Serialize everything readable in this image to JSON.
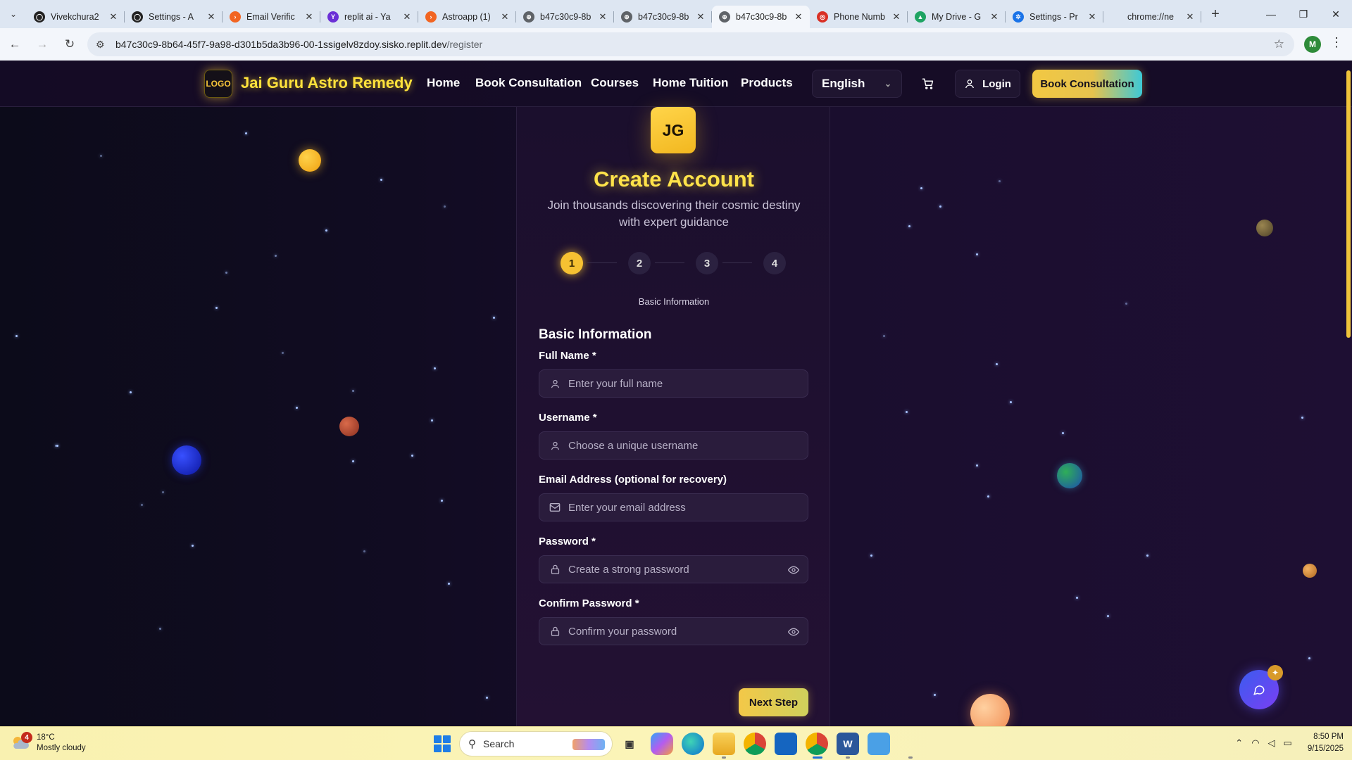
{
  "browser": {
    "tabs": [
      {
        "title": "Vivekchura2",
        "fav_color": "#222222",
        "fav_text": "◯"
      },
      {
        "title": "Settings - A",
        "fav_color": "#222222",
        "fav_text": "◯"
      },
      {
        "title": "Email Verific",
        "fav_color": "#f26522",
        "fav_text": "›"
      },
      {
        "title": "replit ai - Ya",
        "fav_color": "#6b2fd6",
        "fav_text": "Y"
      },
      {
        "title": "Astroapp (1)",
        "fav_color": "#f26522",
        "fav_text": "›"
      },
      {
        "title": "b47c30c9-8b",
        "fav_color": "#5f6368",
        "fav_text": "⊕"
      },
      {
        "title": "b47c30c9-8b",
        "fav_color": "#5f6368",
        "fav_text": "⊕"
      },
      {
        "title": "b47c30c9-8b",
        "fav_color": "#5f6368",
        "fav_text": "⊕",
        "active": true
      },
      {
        "title": "Phone Numb",
        "fav_color": "#d93025",
        "fav_text": "◎"
      },
      {
        "title": "My Drive - G",
        "fav_color": "#1fa463",
        "fav_text": "▲"
      },
      {
        "title": "Settings - Pr",
        "fav_color": "#1a73e8",
        "fav_text": "✲"
      },
      {
        "title": "chrome://ne",
        "fav_color": "#dde6f2",
        "fav_text": ""
      }
    ],
    "url_main": "b47c30c9-8b64-45f7-9a98-d301b5da3b96-00-1ssigelv8zdoy.sisko.replit.dev",
    "url_path": "/register",
    "profile_initial": "M"
  },
  "header": {
    "logo_text": "LOGO",
    "brand": "Jai Guru Astro Remedy",
    "nav": [
      "Home",
      "Book Consultation",
      "Courses",
      "Home Tuition",
      "Products"
    ],
    "language": "English",
    "login_label": "Login",
    "cta_label": "Book Consultation"
  },
  "register": {
    "avatar": "JG",
    "title": "Create Account",
    "subtitle": "Join thousands discovering their cosmic destiny with expert guidance",
    "steps": [
      "1",
      "2",
      "3",
      "4"
    ],
    "active_step": 1,
    "step_caption": "Basic Information",
    "section_title": "Basic Information",
    "fields": [
      {
        "label": "Full Name *",
        "placeholder": "Enter your full name",
        "icon": "user-icon"
      },
      {
        "label": "Username *",
        "placeholder": "Choose a unique username",
        "icon": "user-icon"
      },
      {
        "label": "Email Address (optional for recovery)",
        "placeholder": "Enter your email address",
        "icon": "mail-icon"
      },
      {
        "label": "Password *",
        "placeholder": "Create a strong password",
        "icon": "lock-icon",
        "toggle": "eye-icon"
      },
      {
        "label": "Confirm Password *",
        "placeholder": "Confirm your password",
        "icon": "lock-icon",
        "toggle": "eye-icon"
      }
    ],
    "next_label": "Next Step"
  },
  "taskbar": {
    "weather_temp": "18°C",
    "weather_desc": "Mostly cloudy",
    "weather_badge": "4",
    "search_label": "Search",
    "time": "8:50 PM",
    "date": "9/15/2025"
  },
  "colors": {
    "accent_gold": "#ffe23c",
    "step_active": "#f6c132",
    "page_bg": "#110c22"
  }
}
